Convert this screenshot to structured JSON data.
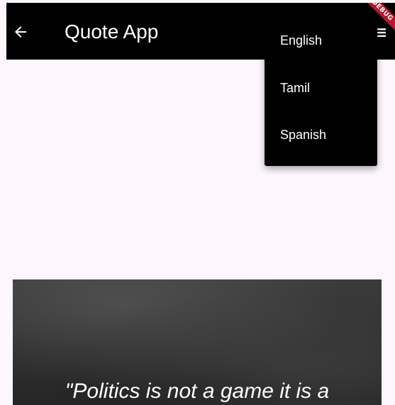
{
  "app_bar": {
    "title": "Quote App",
    "back_icon": "arrow-left-icon",
    "menu_icon": "menu-icon",
    "background": "#000000"
  },
  "debug_banner": {
    "label": "DEBUG",
    "color": "#b4182c"
  },
  "language_menu": {
    "items": [
      {
        "label": "English"
      },
      {
        "label": "Tamil"
      },
      {
        "label": "Spanish"
      }
    ]
  },
  "quote_card": {
    "text": "\"Politics is not a game it is a"
  }
}
